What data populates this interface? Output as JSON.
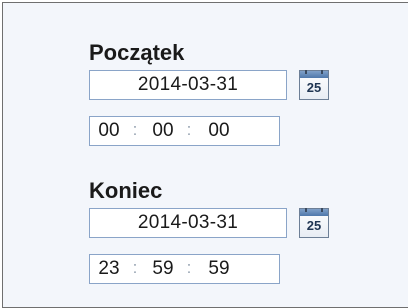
{
  "start": {
    "title": "Początek",
    "date": "2014-03-31",
    "hour": "00",
    "minute": "00",
    "second": "00",
    "calendar_day": "25"
  },
  "end": {
    "title": "Koniec",
    "date": "2014-03-31",
    "hour": "23",
    "minute": "59",
    "second": "59",
    "calendar_day": "25"
  },
  "time_separator": ":",
  "icons": {
    "calendar": "calendar-icon"
  },
  "colors": {
    "panel_background": "#f3f6fb",
    "field_border": "#8aa4c8",
    "calendar_header": "#4f78ab"
  }
}
